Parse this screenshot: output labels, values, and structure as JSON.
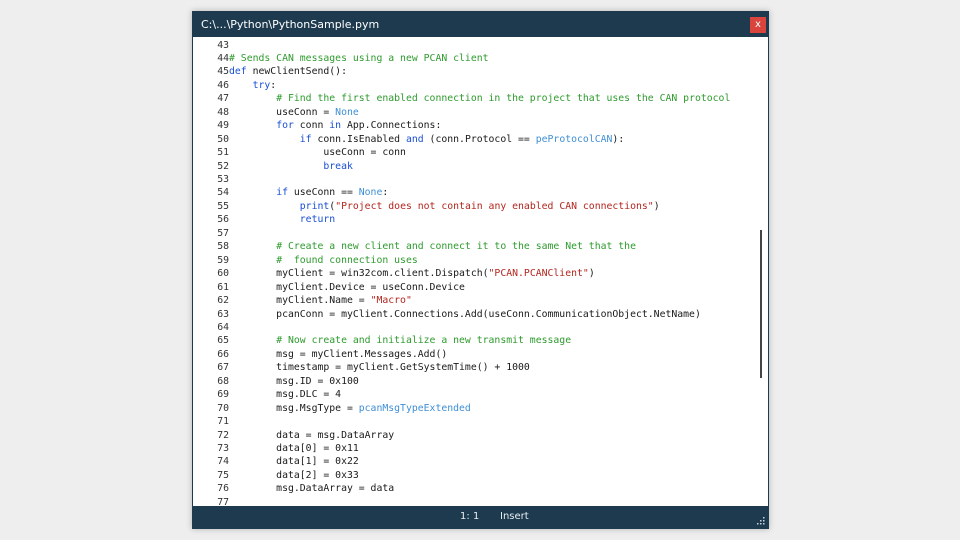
{
  "window": {
    "title": "C:\\...\\Python\\PythonSample.pym",
    "close_label": "x"
  },
  "status": {
    "line": "1",
    "col": "1",
    "mode": "Insert"
  },
  "colors": {
    "titlebar": "#1e3a4f",
    "close": "#d9453c",
    "comment": "#2e9b2e",
    "keyword": "#1a4fd6",
    "constant": "#3f8fd6",
    "string": "#b3261e"
  },
  "lines": [
    {
      "n": "43",
      "tokens": []
    },
    {
      "n": "44",
      "tokens": [
        {
          "t": "# Sends CAN messages using a new PCAN client",
          "c": "com"
        }
      ]
    },
    {
      "n": "45",
      "tokens": [
        {
          "t": "def",
          "c": "kw"
        },
        {
          "t": " newClientSend():",
          "c": "pl"
        }
      ]
    },
    {
      "n": "46",
      "tokens": [
        {
          "t": "    "
        },
        {
          "t": "try",
          "c": "kw"
        },
        {
          "t": ":",
          "c": "pl"
        }
      ]
    },
    {
      "n": "47",
      "tokens": [
        {
          "t": "        "
        },
        {
          "t": "# Find the first enabled connection in the project that uses the CAN protocol",
          "c": "com"
        }
      ]
    },
    {
      "n": "48",
      "tokens": [
        {
          "t": "        useConn = ",
          "c": "pl"
        },
        {
          "t": "None",
          "c": "const"
        }
      ]
    },
    {
      "n": "49",
      "tokens": [
        {
          "t": "        "
        },
        {
          "t": "for",
          "c": "kw"
        },
        {
          "t": " conn ",
          "c": "pl"
        },
        {
          "t": "in",
          "c": "kw"
        },
        {
          "t": " App.Connections:",
          "c": "pl"
        }
      ]
    },
    {
      "n": "50",
      "tokens": [
        {
          "t": "            "
        },
        {
          "t": "if",
          "c": "kw"
        },
        {
          "t": " conn.IsEnabled ",
          "c": "pl"
        },
        {
          "t": "and",
          "c": "kw"
        },
        {
          "t": " (conn.Protocol == ",
          "c": "pl"
        },
        {
          "t": "peProtocolCAN",
          "c": "const"
        },
        {
          "t": "):",
          "c": "pl"
        }
      ]
    },
    {
      "n": "51",
      "tokens": [
        {
          "t": "                useConn = conn",
          "c": "pl"
        }
      ]
    },
    {
      "n": "52",
      "tokens": [
        {
          "t": "                "
        },
        {
          "t": "break",
          "c": "kw"
        }
      ]
    },
    {
      "n": "53",
      "tokens": []
    },
    {
      "n": "54",
      "tokens": [
        {
          "t": "        "
        },
        {
          "t": "if",
          "c": "kw"
        },
        {
          "t": " useConn == ",
          "c": "pl"
        },
        {
          "t": "None",
          "c": "const"
        },
        {
          "t": ":",
          "c": "pl"
        }
      ]
    },
    {
      "n": "55",
      "tokens": [
        {
          "t": "            "
        },
        {
          "t": "print",
          "c": "kw"
        },
        {
          "t": "(",
          "c": "pl"
        },
        {
          "t": "\"Project does not contain any enabled CAN connections\"",
          "c": "str"
        },
        {
          "t": ")",
          "c": "pl"
        }
      ]
    },
    {
      "n": "56",
      "tokens": [
        {
          "t": "            "
        },
        {
          "t": "return",
          "c": "kw"
        }
      ]
    },
    {
      "n": "57",
      "tokens": []
    },
    {
      "n": "58",
      "tokens": [
        {
          "t": "        "
        },
        {
          "t": "# Create a new client and connect it to the same Net that the",
          "c": "com"
        }
      ]
    },
    {
      "n": "59",
      "tokens": [
        {
          "t": "        "
        },
        {
          "t": "#  found connection uses",
          "c": "com"
        }
      ]
    },
    {
      "n": "60",
      "tokens": [
        {
          "t": "        myClient = win32com.client.Dispatch(",
          "c": "pl"
        },
        {
          "t": "\"PCAN.PCANClient\"",
          "c": "str"
        },
        {
          "t": ")",
          "c": "pl"
        }
      ]
    },
    {
      "n": "61",
      "tokens": [
        {
          "t": "        myClient.Device = useConn.Device",
          "c": "pl"
        }
      ]
    },
    {
      "n": "62",
      "tokens": [
        {
          "t": "        myClient.Name = ",
          "c": "pl"
        },
        {
          "t": "\"Macro\"",
          "c": "str"
        }
      ]
    },
    {
      "n": "63",
      "tokens": [
        {
          "t": "        pcanConn = myClient.Connections.Add(useConn.CommunicationObject.NetName)",
          "c": "pl"
        }
      ]
    },
    {
      "n": "64",
      "tokens": []
    },
    {
      "n": "65",
      "tokens": [
        {
          "t": "        "
        },
        {
          "t": "# Now create and initialize a new transmit message",
          "c": "com"
        }
      ]
    },
    {
      "n": "66",
      "tokens": [
        {
          "t": "        msg = myClient.Messages.Add()",
          "c": "pl"
        }
      ]
    },
    {
      "n": "67",
      "tokens": [
        {
          "t": "        timestamp = myClient.GetSystemTime() + 1000",
          "c": "pl"
        }
      ]
    },
    {
      "n": "68",
      "tokens": [
        {
          "t": "        msg.ID = 0x100",
          "c": "pl"
        }
      ]
    },
    {
      "n": "69",
      "tokens": [
        {
          "t": "        msg.DLC = 4",
          "c": "pl"
        }
      ]
    },
    {
      "n": "70",
      "tokens": [
        {
          "t": "        msg.MsgType = ",
          "c": "pl"
        },
        {
          "t": "pcanMsgTypeExtended",
          "c": "const"
        }
      ]
    },
    {
      "n": "71",
      "tokens": []
    },
    {
      "n": "72",
      "tokens": [
        {
          "t": "        data = msg.DataArray",
          "c": "pl"
        }
      ]
    },
    {
      "n": "73",
      "tokens": [
        {
          "t": "        data[0] = 0x11",
          "c": "pl"
        }
      ]
    },
    {
      "n": "74",
      "tokens": [
        {
          "t": "        data[1] = 0x22",
          "c": "pl"
        }
      ]
    },
    {
      "n": "75",
      "tokens": [
        {
          "t": "        data[2] = 0x33",
          "c": "pl"
        }
      ]
    },
    {
      "n": "76",
      "tokens": [
        {
          "t": "        msg.DataArray = data",
          "c": "pl"
        }
      ]
    },
    {
      "n": "77",
      "tokens": []
    }
  ]
}
